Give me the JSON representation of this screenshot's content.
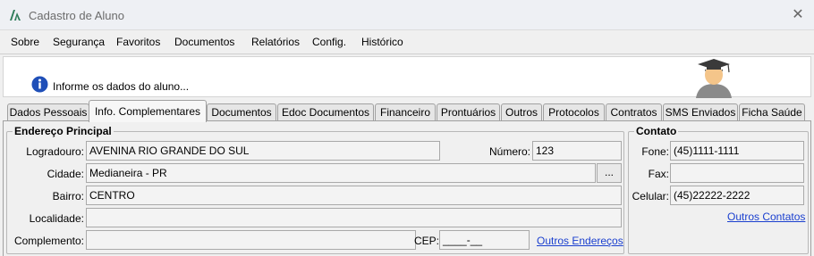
{
  "window": {
    "title": "Cadastro de Aluno",
    "close": "✕"
  },
  "menu": [
    {
      "label": "Sobre"
    },
    {
      "label": "Segurança"
    },
    {
      "label": "Favoritos"
    },
    {
      "label": "Documentos"
    },
    {
      "label": "Relatórios"
    },
    {
      "label": "Config."
    },
    {
      "label": "Histórico"
    }
  ],
  "banner": {
    "message": "Informe os dados do aluno..."
  },
  "tabs": [
    {
      "label": "Dados Pessoais"
    },
    {
      "label": "Info. Complementares",
      "active": true
    },
    {
      "label": "Documentos"
    },
    {
      "label": "Edoc Documentos"
    },
    {
      "label": "Financeiro"
    },
    {
      "label": "Prontuários"
    },
    {
      "label": "Outros"
    },
    {
      "label": "Protocolos"
    },
    {
      "label": "Contratos"
    },
    {
      "label": "SMS Enviados"
    },
    {
      "label": "Ficha Saúde"
    }
  ],
  "endereco": {
    "title": "Endereço Principal",
    "logradouro_label": "Logradouro:",
    "logradouro": "AVENINA RIO GRANDE DO SUL",
    "numero_label": "Número:",
    "numero": "123",
    "cidade_label": "Cidade:",
    "cidade": "Medianeira - PR",
    "cidade_button": "...",
    "bairro_label": "Bairro:",
    "bairro": "CENTRO",
    "localidade_label": "Localidade:",
    "localidade": "",
    "complemento_label": "Complemento:",
    "complemento": "",
    "cep_label": "CEP:",
    "cep": "____-__",
    "outros_enderecos": "Outros Endereços"
  },
  "contato": {
    "title": "Contato",
    "fone_label": "Fone:",
    "fone": "(45)1111-1111",
    "fax_label": "Fax:",
    "fax": "",
    "celular_label": "Celular:",
    "celular": "(45)22222-2222",
    "outros_contatos": "Outros Contatos"
  },
  "colors": {
    "link": "#1a3fcf",
    "info_icon": "#1f4fb8",
    "app_icon": "#2f7d5a"
  }
}
